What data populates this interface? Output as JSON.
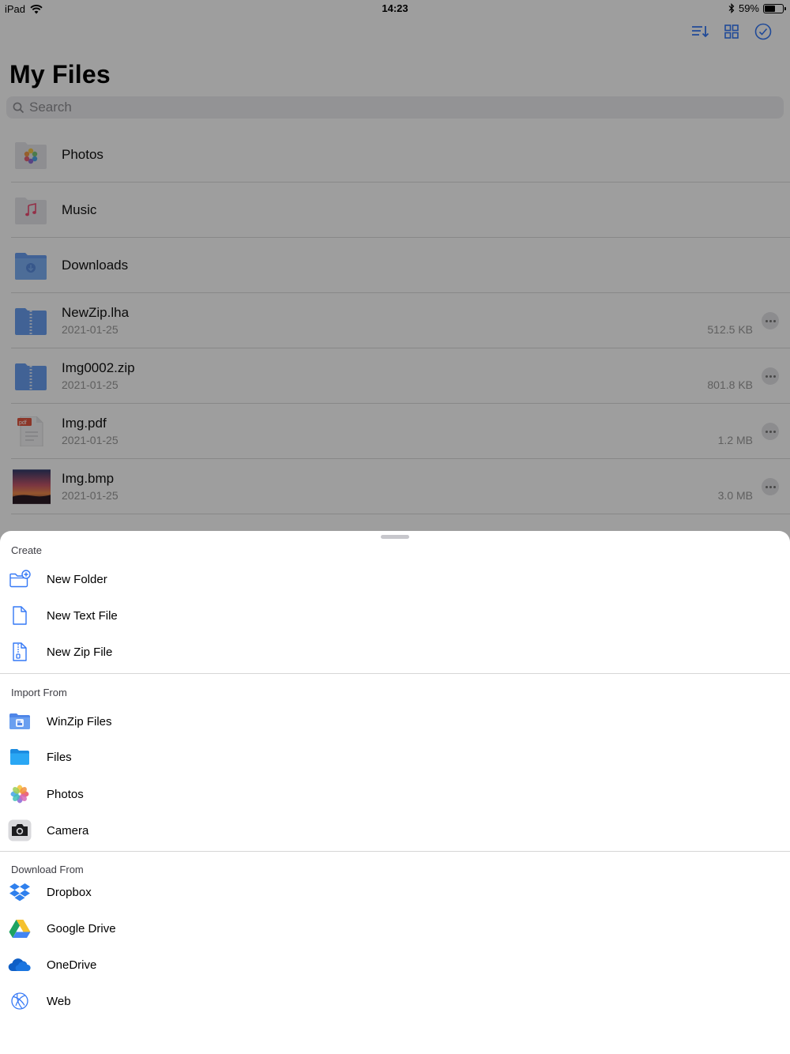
{
  "status_bar": {
    "device": "iPad",
    "time": "14:23",
    "battery_percent": "59%",
    "battery_level": 0.59
  },
  "toolbar": {
    "icons": [
      "sort-icon",
      "grid-view-icon",
      "select-checkmark-icon"
    ]
  },
  "page": {
    "title": "My Files",
    "search_placeholder": "Search"
  },
  "files": [
    {
      "name": "Photos",
      "type": "photos-folder"
    },
    {
      "name": "Music",
      "type": "music-folder"
    },
    {
      "name": "Downloads",
      "type": "downloads-folder"
    },
    {
      "name": "NewZip.lha",
      "date": "2021-01-25",
      "size": "512.5 KB",
      "type": "zip-folder"
    },
    {
      "name": "Img0002.zip",
      "date": "2021-01-25",
      "size": "801.8 KB",
      "type": "zip-folder"
    },
    {
      "name": "Img.pdf",
      "date": "2021-01-25",
      "size": "1.2 MB",
      "type": "pdf-file"
    },
    {
      "name": "Img.bmp",
      "date": "2021-01-25",
      "size": "3.0 MB",
      "type": "image-file"
    }
  ],
  "sheet": {
    "create": {
      "title": "Create",
      "items": [
        {
          "label": "New Folder",
          "icon": "new-folder-icon"
        },
        {
          "label": "New Text File",
          "icon": "new-text-file-icon"
        },
        {
          "label": "New Zip File",
          "icon": "new-zip-file-icon"
        }
      ]
    },
    "import": {
      "title": "Import From",
      "items": [
        {
          "label": "WinZip Files",
          "icon": "winzip-files-icon"
        },
        {
          "label": "Files",
          "icon": "files-app-icon"
        },
        {
          "label": "Photos",
          "icon": "photos-app-icon"
        },
        {
          "label": "Camera",
          "icon": "camera-icon"
        }
      ]
    },
    "download": {
      "title": "Download From",
      "items": [
        {
          "label": "Dropbox",
          "icon": "dropbox-icon"
        },
        {
          "label": "Google Drive",
          "icon": "google-drive-icon"
        },
        {
          "label": "OneDrive",
          "icon": "onedrive-icon"
        },
        {
          "label": "Web",
          "icon": "web-globe-icon"
        }
      ]
    }
  },
  "colors": {
    "accent": "#3478f6",
    "folder": "#6a9ff0",
    "dim_overlay": "rgba(0,0,0,0.38)"
  }
}
